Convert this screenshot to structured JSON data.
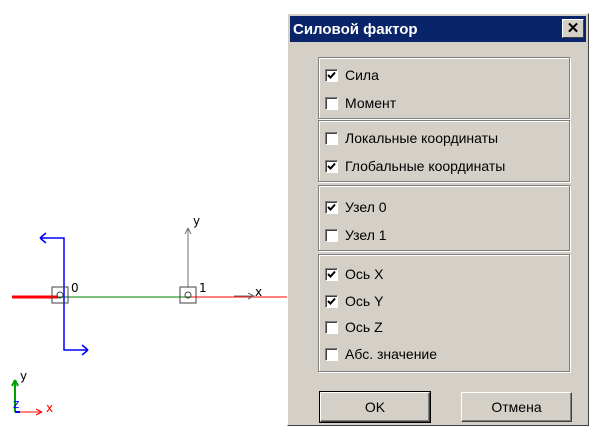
{
  "dialog": {
    "title": "Силовой фактор",
    "close_symbol": "✕",
    "groups": [
      {
        "items": [
          {
            "label": "Сила",
            "checked": true
          },
          {
            "label": "Момент",
            "checked": false
          }
        ]
      },
      {
        "items": [
          {
            "label": "Локальные координаты",
            "checked": false
          },
          {
            "label": "Глобальные координаты",
            "checked": true
          }
        ]
      },
      {
        "items": [
          {
            "label": "Узел 0",
            "checked": true
          },
          {
            "label": "Узел 1",
            "checked": false
          }
        ]
      },
      {
        "items": [
          {
            "label": "Ось X",
            "checked": true
          },
          {
            "label": "Ось Y",
            "checked": true
          },
          {
            "label": "Ось Z",
            "checked": false
          },
          {
            "label": "Абс. значение",
            "checked": false
          }
        ]
      }
    ],
    "buttons": {
      "ok": "OK",
      "cancel": "Отмена"
    }
  },
  "viewport": {
    "node0_label": "0",
    "node1_label": "1",
    "node1_axis_y": "y",
    "node1_axis_x": "x",
    "origin_axis_y": "y",
    "origin_axis_z": "z",
    "origin_axis_x": "x",
    "colors": {
      "x_axis": "#ff0000",
      "y_axis": "#00a000",
      "z_axis": "#0000ff",
      "element": "#008000"
    }
  }
}
